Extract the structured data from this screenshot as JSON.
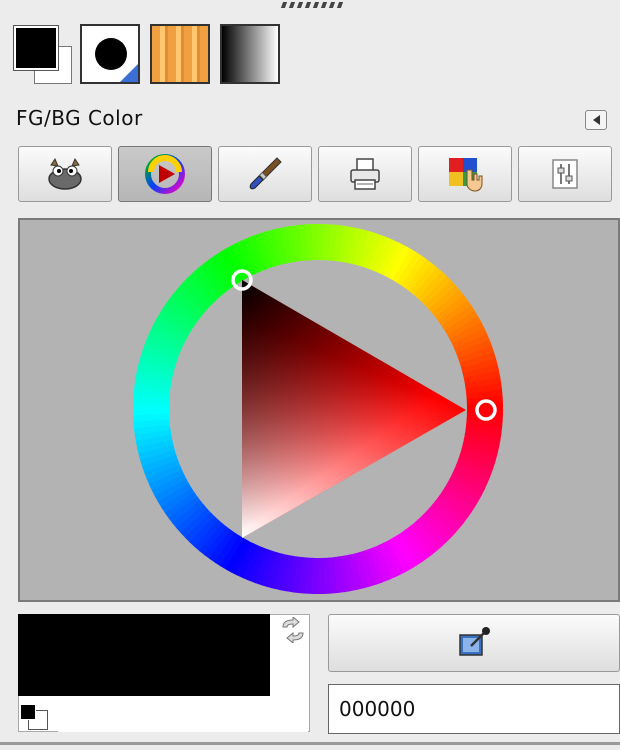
{
  "dock": {
    "title": "FG/BG Color",
    "menu_button_icon": "triangle-left-icon"
  },
  "toolbar_thumbs": [
    {
      "name": "fg-bg-color-indicator",
      "icon": "fg-bg-swatch-icon"
    },
    {
      "name": "brush-preview",
      "icon": "brush-circle-icon"
    },
    {
      "name": "pattern-preview",
      "icon": "wood-pattern-icon"
    },
    {
      "name": "gradient-preview",
      "icon": "black-white-gradient-icon"
    }
  ],
  "selector_tabs": [
    {
      "icon": "gimp-wilber-icon",
      "active": false
    },
    {
      "icon": "color-wheel-icon",
      "active": true
    },
    {
      "icon": "paintbrush-icon",
      "active": false
    },
    {
      "icon": "printer-cmyk-icon",
      "active": false
    },
    {
      "icon": "color-history-hand-icon",
      "active": false
    },
    {
      "icon": "sliders-icon",
      "active": false
    }
  ],
  "colors": {
    "foreground": "#000000",
    "background": "#ffffff",
    "hue_selected": "#ff0000"
  },
  "hex": {
    "value": "000000"
  },
  "buttons": {
    "swap_icon": "swap-arrows-icon",
    "color_picker_icon": "eyedropper-icon"
  }
}
